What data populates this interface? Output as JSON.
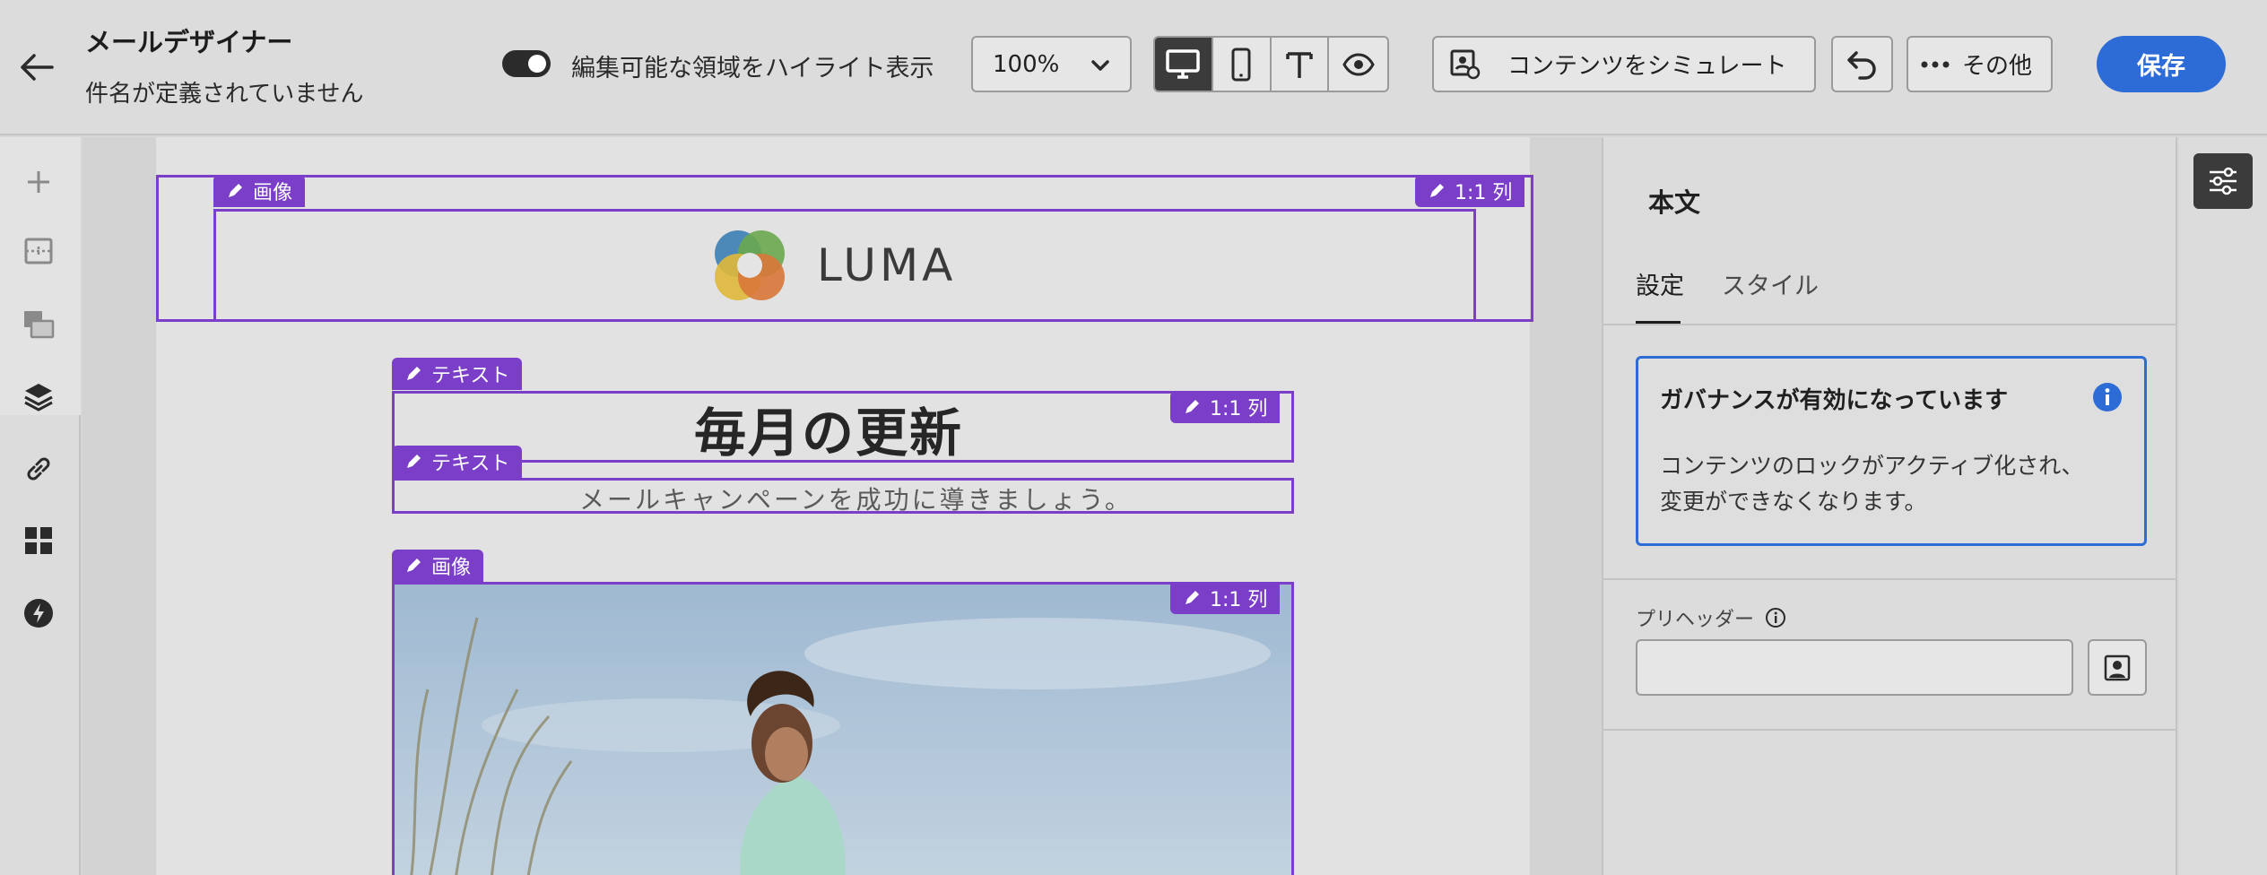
{
  "header": {
    "title": "メールデザイナー",
    "subtitle": "件名が定義されていません",
    "highlight_toggle_label": "編集可能な領域をハイライト表示",
    "zoom_value": "100%",
    "simulate_label": "コンテンツをシミュレート",
    "more_label": "その他",
    "save_label": "保存"
  },
  "canvas": {
    "image_tag": "画像",
    "column_tag": "1:1 列",
    "text_tag": "テキスト",
    "logo_text": "LUMA",
    "headline": "毎月の更新",
    "subline": "メールキャンペーンを成功に導きましょう。"
  },
  "panel": {
    "title": "本文",
    "tabs": [
      "設定",
      "スタイル"
    ],
    "governance_title": "ガバナンスが有効になっています",
    "governance_text": "コンテンツのロックがアクティブ化され、変更ができなくなります。",
    "preheader_label": "プリヘッダー",
    "preheader_value": ""
  },
  "colors": {
    "selection": "#7a3ec8",
    "primary": "#2d6bd6"
  }
}
